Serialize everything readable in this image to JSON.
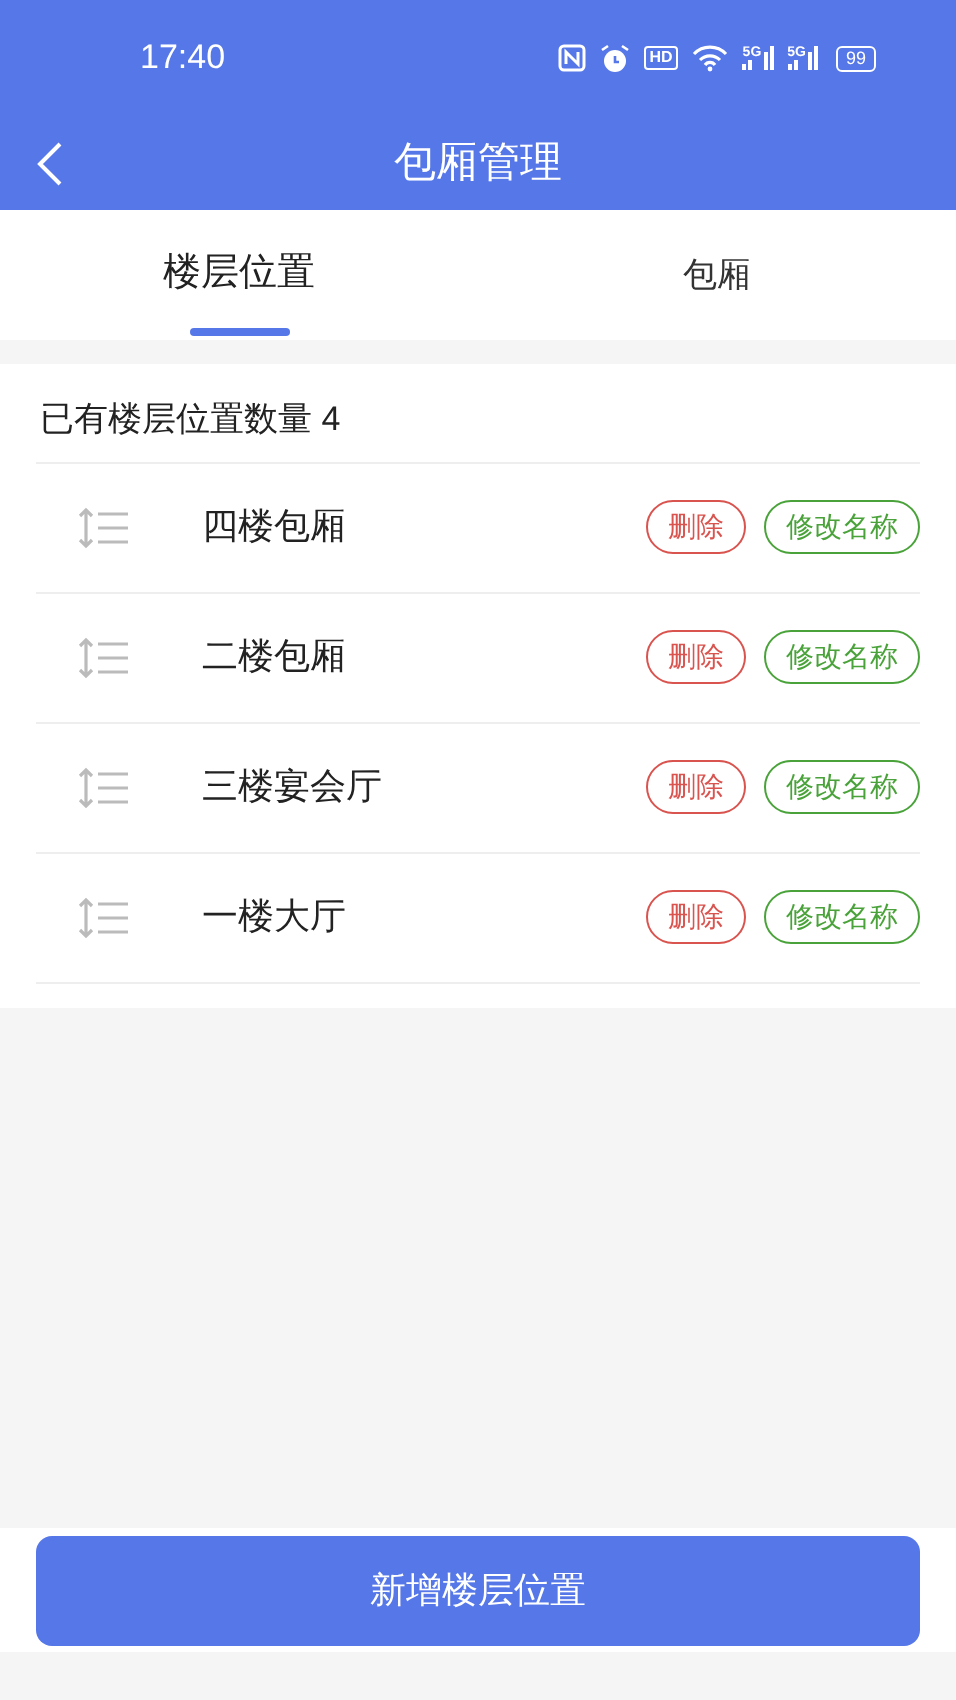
{
  "status_bar": {
    "time": "17:40",
    "hd": "HD",
    "network": [
      "5G",
      "5G"
    ],
    "battery": "99"
  },
  "header": {
    "title": "包厢管理"
  },
  "tabs": [
    {
      "label": "楼层位置",
      "selected": true
    },
    {
      "label": "包厢",
      "selected": false
    }
  ],
  "summary": "已有楼层位置数量 4",
  "floors": [
    {
      "name": "四楼包厢",
      "delete": "删除",
      "rename": "修改名称"
    },
    {
      "name": "二楼包厢",
      "delete": "删除",
      "rename": "修改名称"
    },
    {
      "name": "三楼宴会厅",
      "delete": "删除",
      "rename": "修改名称"
    },
    {
      "name": "一楼大厅",
      "delete": "删除",
      "rename": "修改名称"
    }
  ],
  "add_button": "新增楼层位置"
}
